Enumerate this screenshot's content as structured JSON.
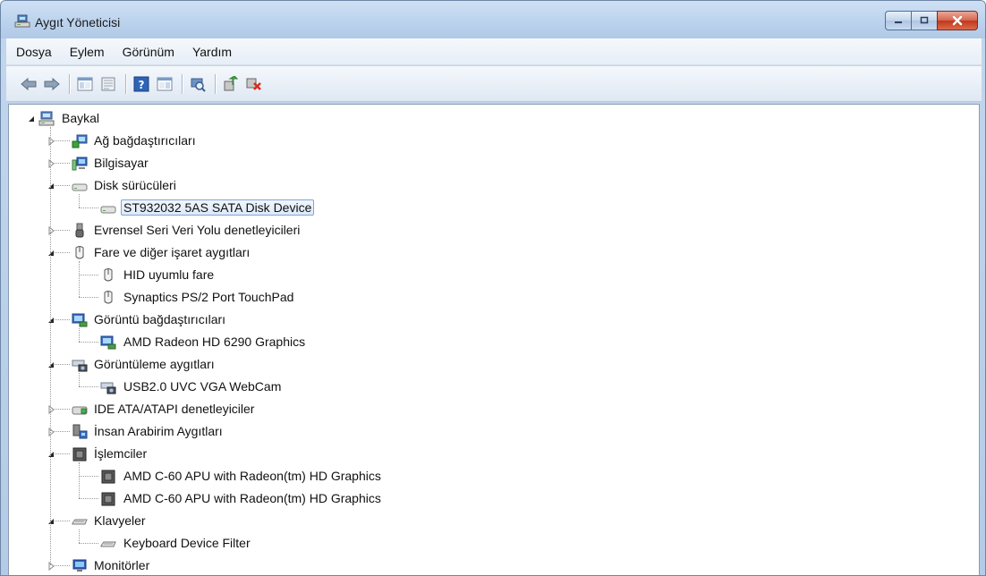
{
  "window": {
    "title": "Aygıt Yöneticisi",
    "accent": "#b9cfe8"
  },
  "menu": [
    "Dosya",
    "Eylem",
    "Görünüm",
    "Yardım"
  ],
  "toolbar": {
    "icons": [
      "back-arrow-icon",
      "forward-arrow-icon",
      "properties-icon",
      "help-icon",
      "scan-hardware-icon",
      "update-driver-icon",
      "uninstall-icon"
    ]
  },
  "tree": {
    "root": "Baykal",
    "categories": [
      {
        "label": "Ağ bağdaştırıcıları",
        "expanded": false,
        "icon": "network-adapter-icon",
        "children": []
      },
      {
        "label": "Bilgisayar",
        "expanded": false,
        "icon": "computer-icon",
        "children": []
      },
      {
        "label": "Disk sürücüleri",
        "expanded": true,
        "icon": "disk-drive-icon",
        "children": [
          "ST932032 5AS SATA Disk Device"
        ]
      },
      {
        "label": "Evrensel Seri Veri Yolu denetleyicileri",
        "expanded": false,
        "icon": "usb-icon",
        "children": []
      },
      {
        "label": "Fare ve diğer işaret aygıtları",
        "expanded": true,
        "icon": "mouse-icon",
        "children": [
          "HID uyumlu fare",
          "Synaptics PS/2 Port TouchPad"
        ]
      },
      {
        "label": "Görüntü bağdaştırıcıları",
        "expanded": true,
        "icon": "display-adapter-icon",
        "children": [
          "AMD Radeon HD 6290 Graphics"
        ]
      },
      {
        "label": "Görüntüleme aygıtları",
        "expanded": true,
        "icon": "imaging-device-icon",
        "children": [
          "USB2.0 UVC VGA WebCam"
        ]
      },
      {
        "label": "IDE ATA/ATAPI denetleyiciler",
        "expanded": false,
        "icon": "ide-controller-icon",
        "children": []
      },
      {
        "label": "İnsan Arabirim Aygıtları",
        "expanded": false,
        "icon": "hid-icon",
        "children": []
      },
      {
        "label": "İşlemciler",
        "expanded": true,
        "icon": "processor-icon",
        "children": [
          "AMD C-60 APU with Radeon(tm) HD Graphics",
          "AMD C-60 APU with Radeon(tm) HD Graphics"
        ]
      },
      {
        "label": "Klavyeler",
        "expanded": true,
        "icon": "keyboard-icon",
        "children": [
          "Keyboard Device Filter"
        ]
      },
      {
        "label": "Monitörler",
        "expanded": false,
        "icon": "monitor-icon",
        "children": []
      }
    ],
    "selected": "ST932032 5AS SATA Disk Device"
  }
}
